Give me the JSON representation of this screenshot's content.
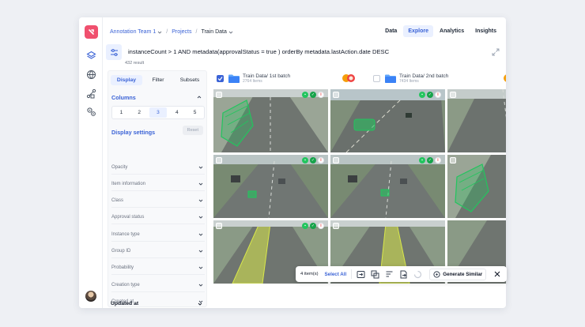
{
  "breadcrumb": {
    "team": "Annotation Team 1",
    "projects": "Projects",
    "current": "Train Data"
  },
  "tabs": [
    "Data",
    "Explore",
    "Analytics",
    "Insights"
  ],
  "query": {
    "text": "instanceCount > 1 AND metadata(approvalStatus = true ) orderBy metadata.lastAction.date DESC",
    "result_count": "432 result"
  },
  "panel": {
    "tabs": [
      "Display",
      "Filter",
      "Subsets"
    ],
    "columns_title": "Columns",
    "column_options": [
      "1",
      "2",
      "3",
      "4",
      "5"
    ],
    "display_settings_title": "Display settings",
    "reset_label": "Reset",
    "settings": [
      "Opacity",
      "Item information",
      "Class",
      "Approval status",
      "Instance type",
      "Group ID",
      "Probability",
      "Creation type",
      "Created at",
      "Updated at"
    ]
  },
  "batches": [
    {
      "name": "Train Data/ 1st batch",
      "count": "2764 Items"
    },
    {
      "name": "Train Data/ 2nd batch",
      "count": "7434 Items"
    }
  ],
  "actionbar": {
    "count": "4 item(s)",
    "select_all": "Select All",
    "generate": "Generate Similar"
  },
  "colors": {
    "accent": "#3b63d6",
    "brand": "#f0506e",
    "annotation": "#22c55e",
    "lane": "#d9e84a"
  }
}
